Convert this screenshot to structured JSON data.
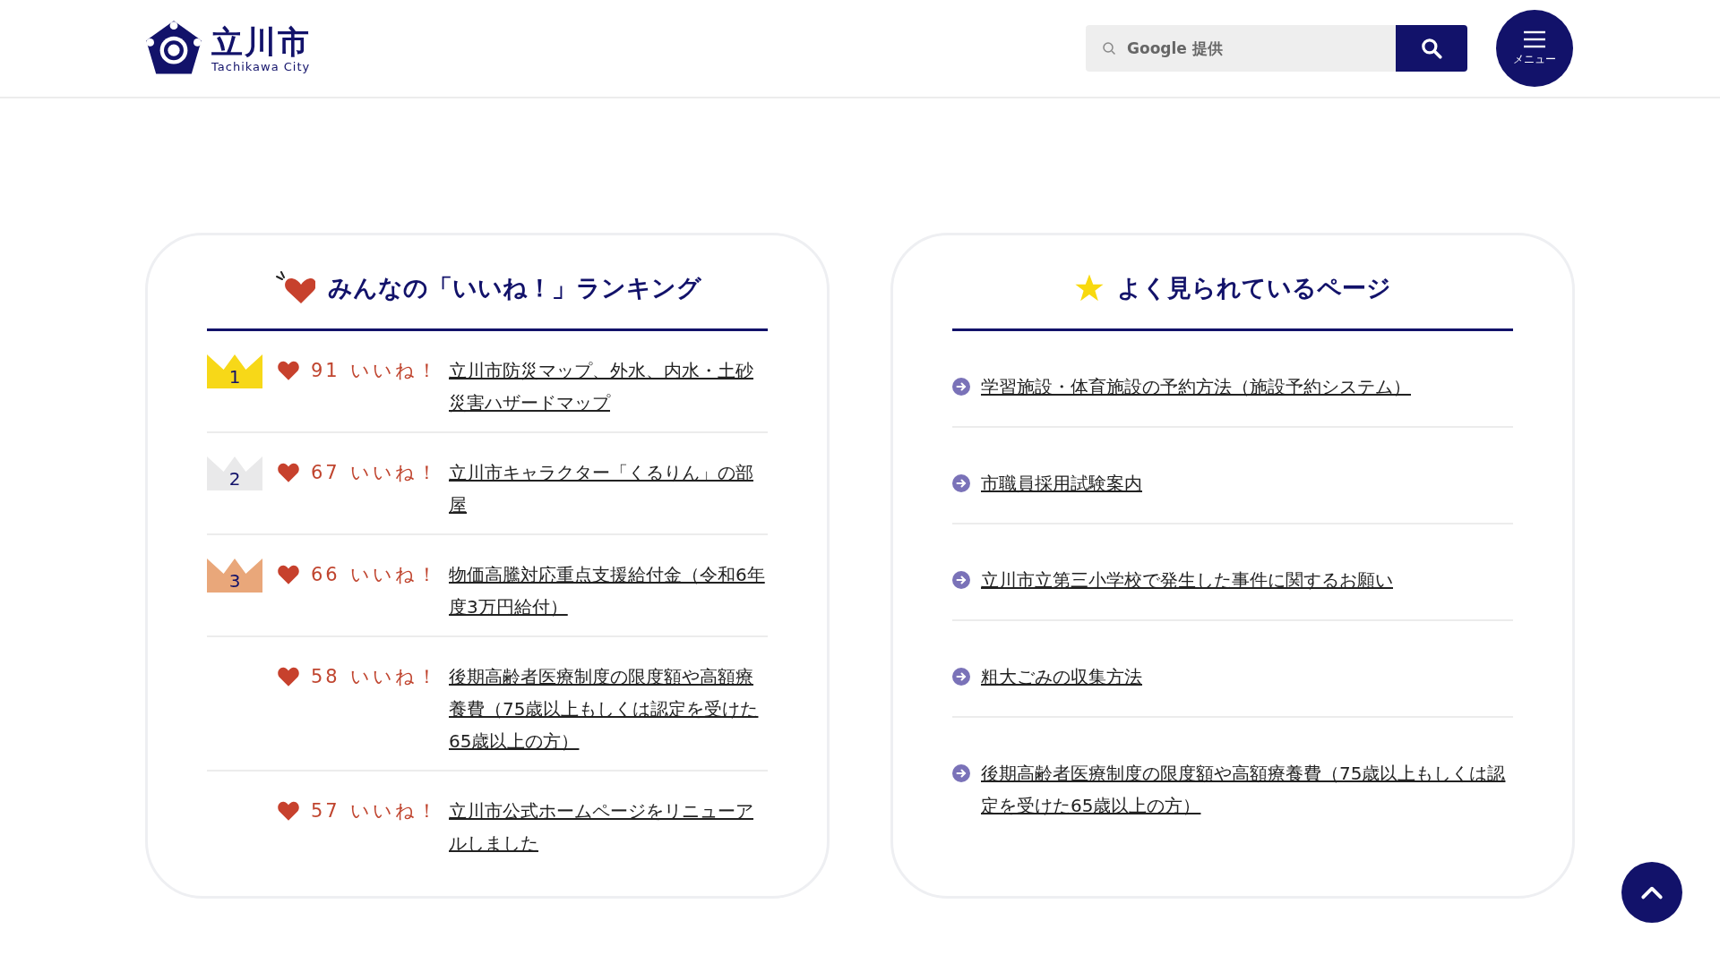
{
  "header": {
    "logo_name": "立川市",
    "logo_sub": "Tachikawa City",
    "search": {
      "placeholder": "Google 提供"
    },
    "menu_label": "メニュー"
  },
  "ranking": {
    "title": "みんなの「いいね！」ランキング",
    "items": [
      {
        "rank": "1",
        "color": "#f7d818",
        "count": "91",
        "like_label": "いいね！",
        "link": "立川市防災マップ、外水、内水・土砂災害ハザードマップ"
      },
      {
        "rank": "2",
        "color": "#e9e9ea",
        "count": "67",
        "like_label": "いいね！",
        "link": "立川市キャラクター「くるりん」の部屋"
      },
      {
        "rank": "3",
        "color": "#e9a77a",
        "count": "66",
        "like_label": "いいね！",
        "link": "物価高騰対応重点支援給付金（令和6年度3万円給付）"
      },
      {
        "count": "58",
        "like_label": "いいね！",
        "link": "後期高齢者医療制度の限度額や高額療養費（75歳以上もしくは認定を受けた65歳以上の方）"
      },
      {
        "count": "57",
        "like_label": "いいね！",
        "link": "立川市公式ホームページをリニューアルしました"
      }
    ]
  },
  "popular": {
    "title": "よく見られているページ",
    "items": [
      "学習施設・体育施設の予約方法（施設予約システム）",
      "市職員採用試験案内",
      "立川市立第三小学校で発生した事件に関するお願い",
      "粗大ごみの収集方法",
      "後期高齢者医療制度の限度額や高額療養費（75歳以上もしくは認定を受けた65歳以上の方）"
    ]
  }
}
